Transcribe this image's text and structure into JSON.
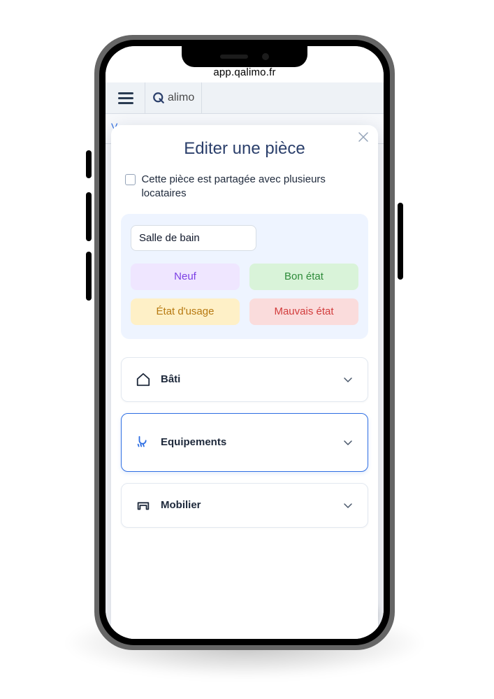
{
  "browser": {
    "url": "app.qalimo.fr"
  },
  "brand": {
    "name": "alimo"
  },
  "modal": {
    "title": "Editer une pièce",
    "share_label": "Cette pièce est partagée avec plusieurs locataires",
    "room_name": "Salle de bain",
    "states": {
      "neuf": "Neuf",
      "bon": "Bon état",
      "usage": "État d'usage",
      "mauvais": "Mauvais état"
    },
    "sections": {
      "bati": "Bâti",
      "equipements": "Equipements",
      "mobilier": "Mobilier"
    }
  }
}
